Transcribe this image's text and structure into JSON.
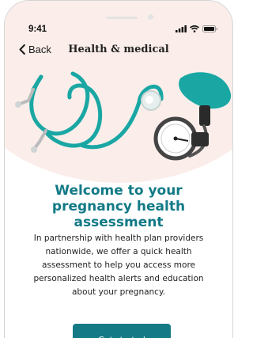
{
  "status_bar": {
    "time": "9:41",
    "icons": [
      "signal-icon",
      "wifi-icon",
      "battery-icon"
    ]
  },
  "nav": {
    "back_label": "Back",
    "title": "Health & medical"
  },
  "hero": {
    "illustration": "stethoscope-and-blood-pressure-cuff"
  },
  "content": {
    "heading": "Welcome to your pregnancy health assessment",
    "body": "In partnership with health plan providers nationwide, we offer a quick health assessment to help you access more personalized health alerts and education about your pregnancy."
  },
  "cta": {
    "label": "Get started"
  },
  "colors": {
    "accent": "#127a86",
    "hero_bg": "#fbeeea",
    "teal_illustration": "#1aa7a4"
  }
}
